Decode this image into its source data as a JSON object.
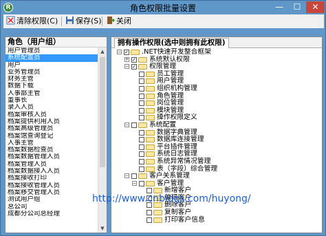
{
  "window": {
    "title": "角色权限批量设置",
    "app_icon": "R",
    "controls": {
      "minimize": "—",
      "maximize": "☐",
      "close": "✕"
    }
  },
  "toolbar": {
    "clear_label": "清除权限(C)",
    "save_label": "保存(S)",
    "close_label": "关闭"
  },
  "roles": {
    "header": "角色（用户组）",
    "items": [
      "用户管理员",
      "系统配置员",
      "用户",
      "业务管理员",
      "财务主管",
      "数据下载",
      "人事部主管",
      "董事长",
      "录入人员",
      "档案审核人员",
      "档案提供利用人员",
      "档案高级管理员",
      "档案馆查询登记",
      "人事主管",
      "档案数据检查员",
      "档案数据管理人员",
      "档案管理人员",
      "档案数据接入人员",
      "档案接收打印",
      "档案接收管理人员",
      "档案移交管理人员",
      "测试用户组",
      "总公司",
      "成都分公司总经理"
    ],
    "selected_index": 1
  },
  "tree": {
    "tab_label": "拥有操作权限(选中则拥有此权限)",
    "nodes": [
      {
        "label": ".NET快速开发整合框架",
        "level": 0,
        "exp": "−",
        "cb": "✓"
      },
      {
        "label": "系统默认权限",
        "level": 1,
        "exp": "+",
        "cb": "✓"
      },
      {
        "label": "权限管理",
        "level": 1,
        "exp": "−",
        "cb": "✓"
      },
      {
        "label": "员工管理",
        "level": 2,
        "exp": "",
        "cb": ""
      },
      {
        "label": "用户管理",
        "level": 2,
        "exp": "",
        "cb": ""
      },
      {
        "label": "组织机构管理",
        "level": 2,
        "exp": "",
        "cb": ""
      },
      {
        "label": "角色管理",
        "level": 2,
        "exp": "",
        "cb": ""
      },
      {
        "label": "岗位管理",
        "level": 2,
        "exp": "",
        "cb": ""
      },
      {
        "label": "模块管理",
        "level": 2,
        "exp": "",
        "cb": ""
      },
      {
        "label": "操作权限定义",
        "level": 2,
        "exp": "",
        "cb": ""
      },
      {
        "label": "系统配置",
        "level": 1,
        "exp": "−",
        "cb": ""
      },
      {
        "label": "数据字典管理",
        "level": 2,
        "exp": "",
        "cb": ""
      },
      {
        "label": "数据库连接管理",
        "level": 2,
        "exp": "",
        "cb": ""
      },
      {
        "label": "平台插件管理",
        "level": 2,
        "exp": "",
        "cb": ""
      },
      {
        "label": "系统日志管理",
        "level": 2,
        "exp": "",
        "cb": ""
      },
      {
        "label": "系统异常情况管理",
        "level": 2,
        "exp": "",
        "cb": ""
      },
      {
        "label": "表（字段）综合管理",
        "level": 2,
        "exp": "",
        "cb": ""
      },
      {
        "label": "客户关系管理",
        "level": 1,
        "exp": "−",
        "cb": ""
      },
      {
        "label": "客户管理",
        "level": 2,
        "exp": "−",
        "cb": ""
      },
      {
        "label": "新增客户",
        "level": 3,
        "exp": "",
        "cb": ""
      },
      {
        "label": "编辑客户",
        "level": 3,
        "exp": "",
        "cb": ""
      },
      {
        "label": "删除客户",
        "level": 3,
        "exp": "",
        "cb": ""
      },
      {
        "label": "复制客户",
        "level": 3,
        "exp": "",
        "cb": ""
      },
      {
        "label": "打印客户信息",
        "level": 3,
        "exp": "",
        "cb": ""
      }
    ]
  },
  "watermark": "http://www.cnblogs.com/huyong/"
}
